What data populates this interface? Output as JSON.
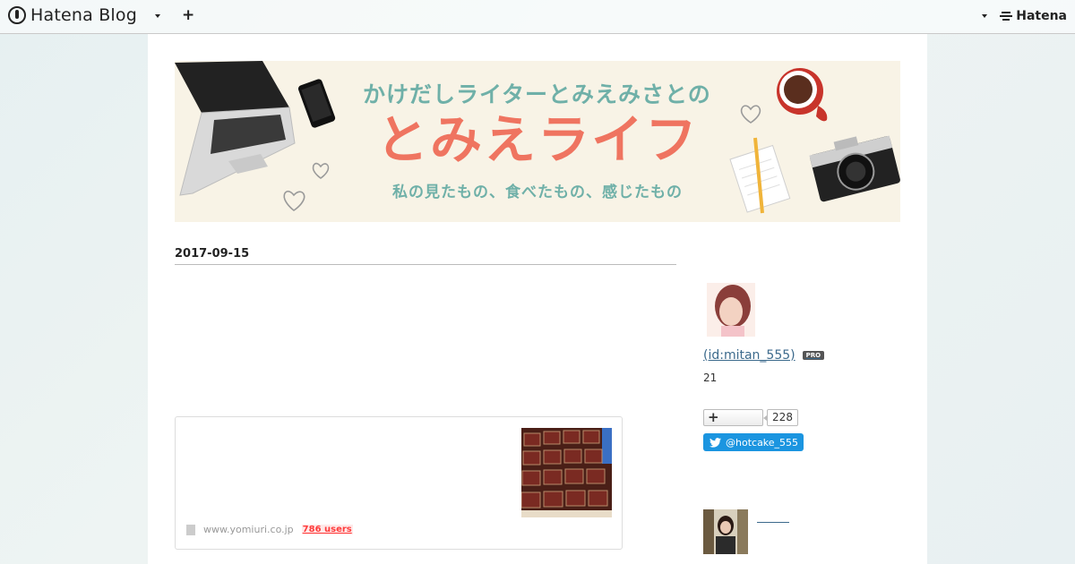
{
  "global_header": {
    "logo_text": "Hatena Blog",
    "add_label": "+",
    "brand_right": "Hatena"
  },
  "banner": {
    "subtitle": "かけだしライターとみえみさとの",
    "title": "とみえライフ",
    "tagline": "私の見たもの、食べたもの、感じたもの",
    "colors": {
      "title": "#ef7460",
      "accent": "#6fb0a8",
      "background": "#f8f3e6"
    }
  },
  "entry": {
    "date": "2017-09-15",
    "embed": {
      "source_domain": "www.yomiuri.co.jp",
      "users_count": "786 users"
    }
  },
  "sidebar": {
    "profile": {
      "id_text": " (id:mitan_555)",
      "pro_badge": "PRO",
      "count": "21"
    },
    "follow": {
      "plus_label": "+",
      "count": "228"
    },
    "twitter": {
      "handle": "@hotcake_555",
      "icon": "twitter-bird-icon",
      "color": "#1b95e0"
    }
  }
}
